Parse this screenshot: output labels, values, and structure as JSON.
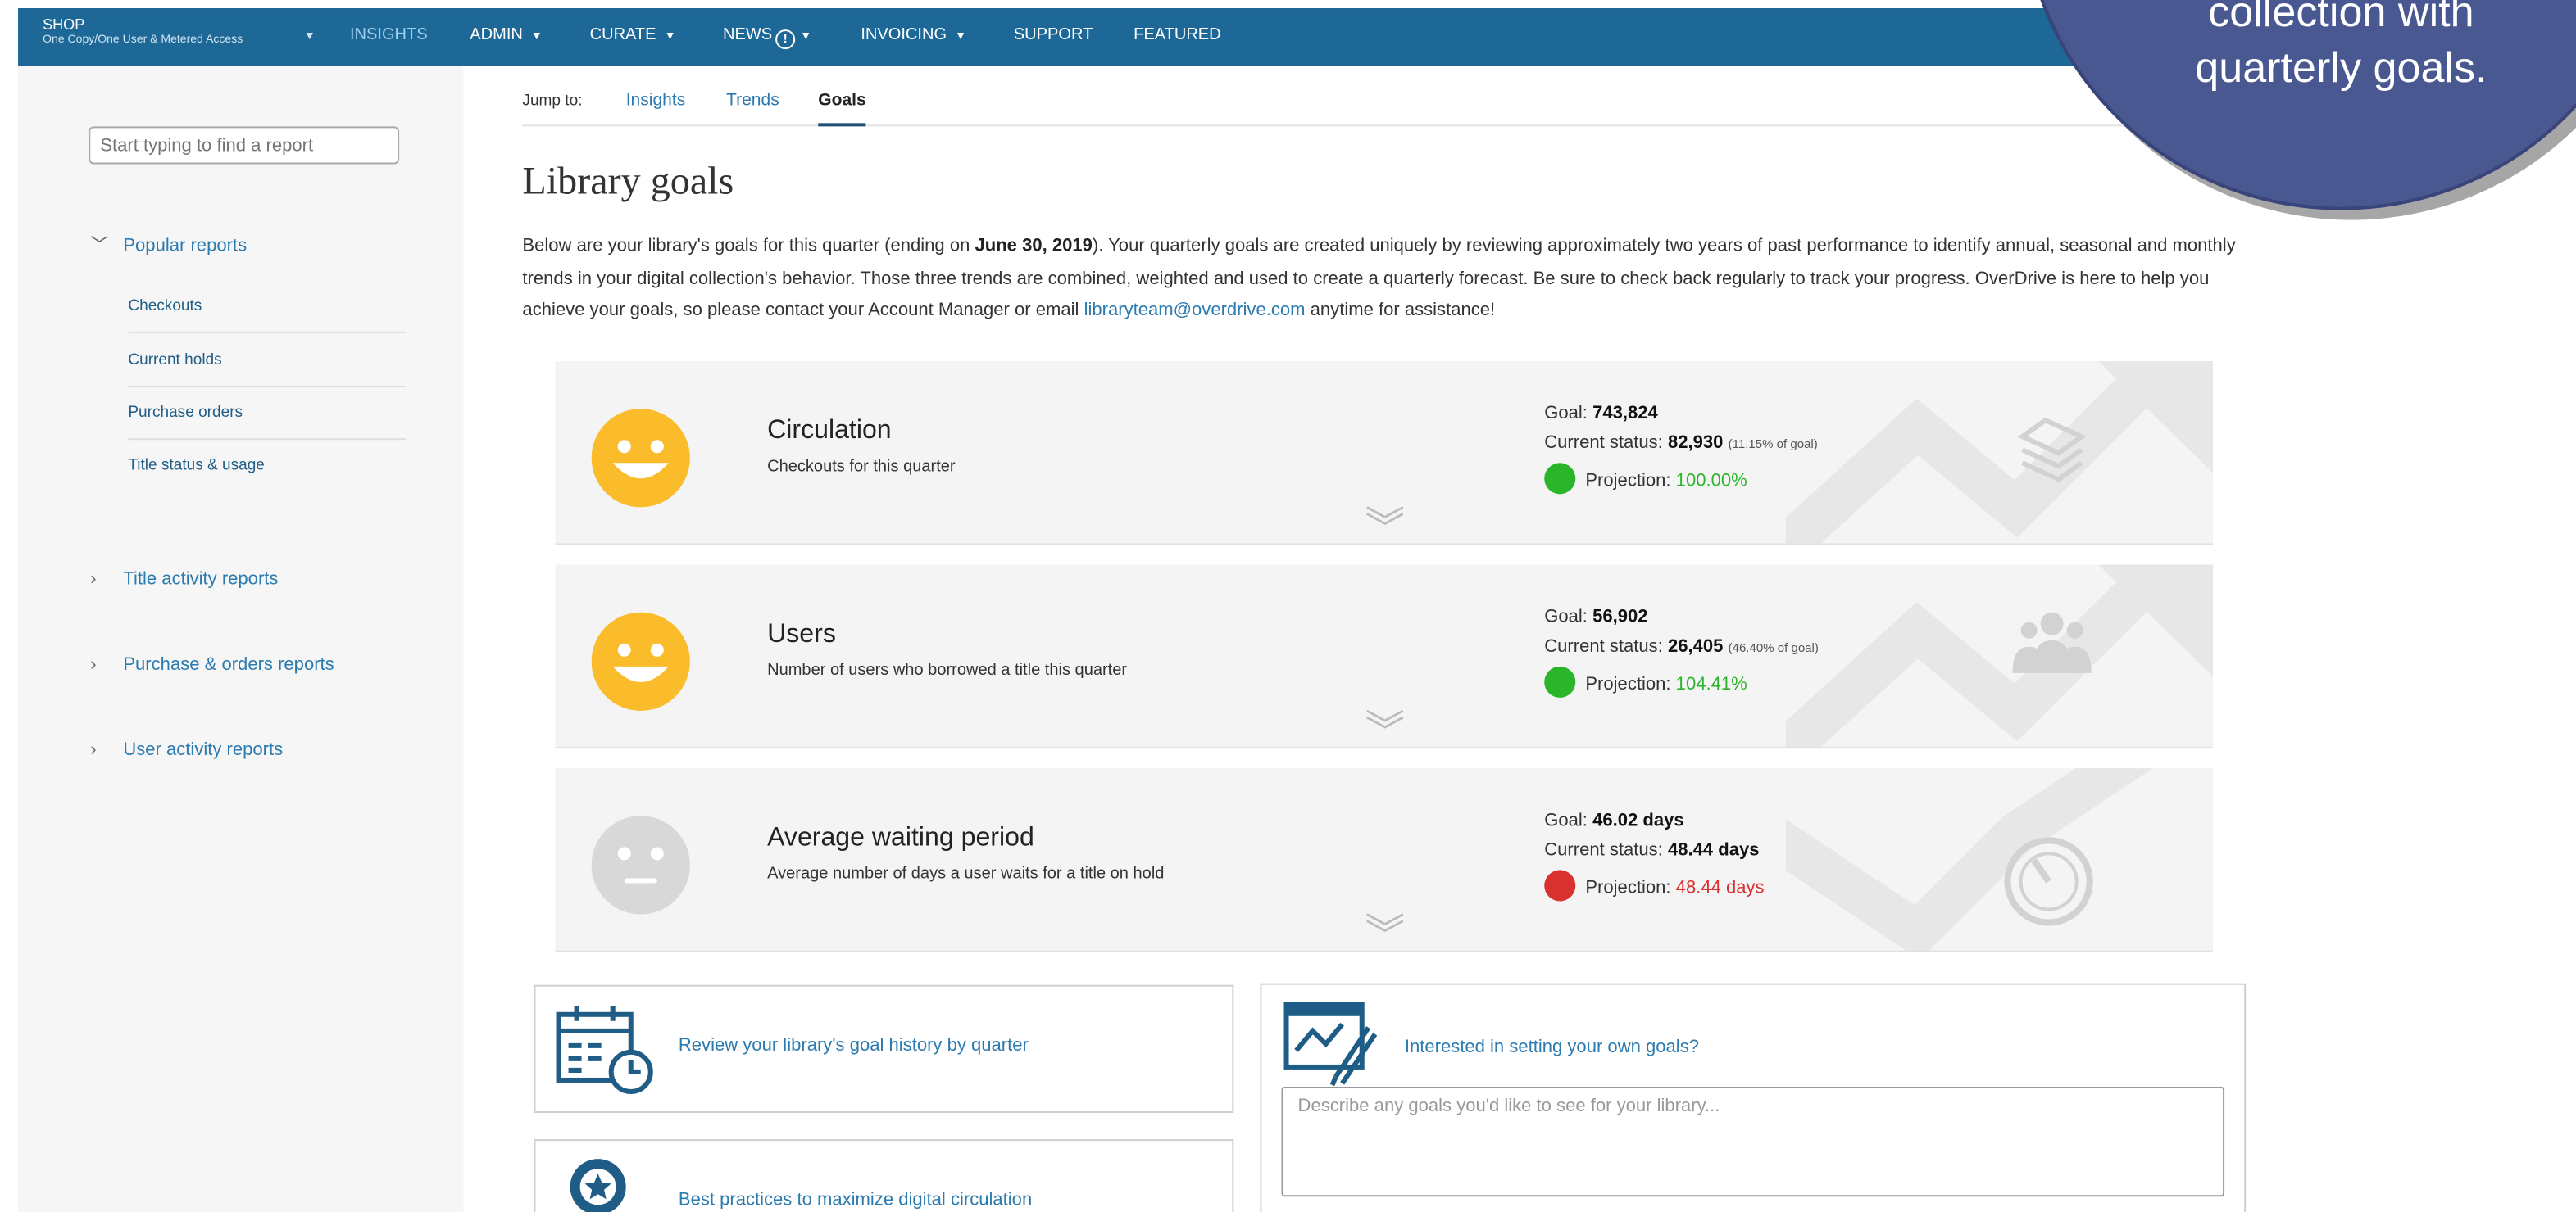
{
  "topnav": {
    "shop_title": "SHOP",
    "shop_subtitle": "One Copy/One User & Metered Access",
    "items": [
      "INSIGHTS",
      "ADMIN",
      "CURATE",
      "NEWS",
      "INVOICING",
      "SUPPORT",
      "FEATURED"
    ],
    "bg_color": "#1d6897"
  },
  "sidebar": {
    "search_placeholder": "Start typing to find a report",
    "popular_heading": "Popular reports",
    "popular_items": [
      "Checkouts",
      "Current holds",
      "Purchase orders",
      "Title status & usage"
    ],
    "sections": [
      "Title activity reports",
      "Purchase & orders reports",
      "User activity reports"
    ]
  },
  "tabs": {
    "label": "Jump to:",
    "items": [
      "Insights",
      "Trends",
      "Goals"
    ],
    "active": "Goals"
  },
  "main": {
    "title": "Library goals",
    "intro_1": "Below are your library's goals for this quarter (ending on ",
    "intro_date": "June 30, 2019",
    "intro_2": "). Your quarterly goals are created uniquely by reviewing approximately two years of past performance to identify annual, seasonal and monthly trends in your digital collection's behavior. Those three trends are combined, weighted and used to create a quarterly forecast. Be sure to check back regularly to track your progress. OverDrive is here to help you achieve your goals, so please contact your Account Manager or email ",
    "intro_email": "libraryteam@overdrive.com",
    "intro_3": " anytime for assistance!"
  },
  "goal_labels": {
    "goal": "Goal:",
    "current": "Current status:",
    "projection": "Projection:"
  },
  "cards": [
    {
      "title": "Circulation",
      "subtitle": "Checkouts for this quarter",
      "goal": "743,824",
      "current": "82,930",
      "current_pct": "(11.15% of goal)",
      "projection": "100.00%",
      "status": "on-track",
      "icon": "books-icon"
    },
    {
      "title": "Users",
      "subtitle": "Number of users who borrowed a title this quarter",
      "goal": "56,902",
      "current": "26,405",
      "current_pct": "(46.40% of goal)",
      "projection": "104.41%",
      "status": "on-track",
      "icon": "people-icon"
    },
    {
      "title": "Average waiting period",
      "subtitle": "Average number of days a user waits for a title on hold",
      "goal": "46.02 days",
      "current": "48.44 days",
      "current_pct": "",
      "projection": "48.44 days",
      "status": "off-track",
      "icon": "gauge-icon"
    }
  ],
  "actions": {
    "history": "Review your library's goal history by quarter",
    "best_practices": "Best practices to maximize digital circulation",
    "own_goals": "Interested in setting your own goals?",
    "goals_placeholder": "Describe any goals you'd like to see for your library..."
  },
  "callout": {
    "text": "collection with\nquarterly goals."
  },
  "colors": {
    "link": "#2c7bb0",
    "smiley_yellow": "#fbbc2c",
    "neutral_gray": "#d8d8d8",
    "green": "#2bb52b",
    "red": "#d93030",
    "callout": "#4a5891"
  }
}
